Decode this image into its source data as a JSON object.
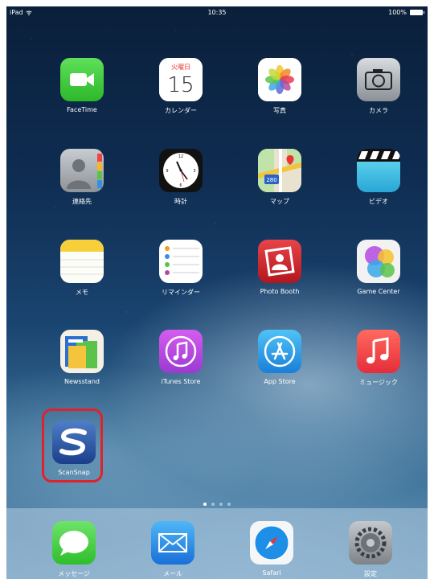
{
  "status_bar": {
    "device": "iPad",
    "time": "10:35",
    "battery": "100%"
  },
  "apps": [
    {
      "label": "FaceTime",
      "icon": "facetime-icon"
    },
    {
      "label": "カレンダー",
      "icon": "calendar-icon",
      "weekday": "火曜日",
      "day": "15"
    },
    {
      "label": "写真",
      "icon": "photos-icon"
    },
    {
      "label": "カメラ",
      "icon": "camera-icon"
    },
    {
      "label": "連絡先",
      "icon": "contacts-icon"
    },
    {
      "label": "時計",
      "icon": "clock-icon"
    },
    {
      "label": "マップ",
      "icon": "maps-icon",
      "route": "280"
    },
    {
      "label": "ビデオ",
      "icon": "videos-icon"
    },
    {
      "label": "メモ",
      "icon": "notes-icon"
    },
    {
      "label": "リマインダー",
      "icon": "reminders-icon"
    },
    {
      "label": "Photo Booth",
      "icon": "photo-booth-icon"
    },
    {
      "label": "Game Center",
      "icon": "game-center-icon"
    },
    {
      "label": "Newsstand",
      "icon": "newsstand-icon"
    },
    {
      "label": "iTunes Store",
      "icon": "itunes-store-icon"
    },
    {
      "label": "App Store",
      "icon": "app-store-icon"
    },
    {
      "label": "ミュージック",
      "icon": "music-icon"
    },
    {
      "label": "ScanSnap",
      "icon": "scansnap-icon"
    }
  ],
  "dock": [
    {
      "label": "メッセージ",
      "icon": "messages-icon"
    },
    {
      "label": "メール",
      "icon": "mail-icon"
    },
    {
      "label": "Safari",
      "icon": "safari-icon"
    },
    {
      "label": "設定",
      "icon": "settings-icon"
    }
  ],
  "page_indicator": {
    "pages": 4,
    "current": 1
  },
  "highlight": {
    "target": "ScanSnap",
    "color": "#e0222a"
  }
}
